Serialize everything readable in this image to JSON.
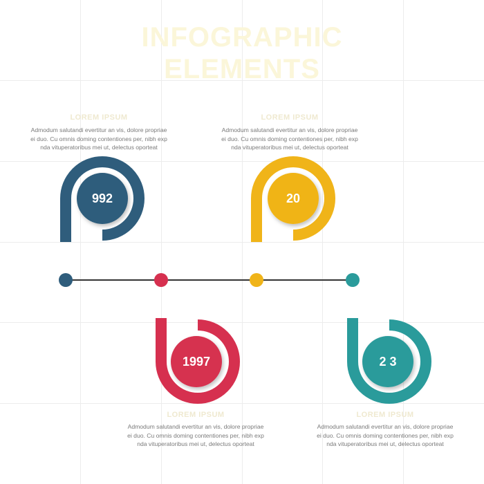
{
  "title": {
    "line1": "INFOGRAPHIC",
    "line2": "ELEMENTS"
  },
  "colors": {
    "steps": [
      "#2f5d7c",
      "#d6304f",
      "#f0b419",
      "#2a9b9b"
    ],
    "timeline": "#333333",
    "grid": "#ececec"
  },
  "steps": [
    {
      "year": "992",
      "heading": "LOREM IPSUM",
      "body": [
        "Admodum salutandi evertitur an vis, dolore propriae",
        "ei duo. Cu omnis doming contentiones per, nibh exp",
        "nda vituperatoribus mei ut, delectus oporteat"
      ]
    },
    {
      "year": "1997",
      "heading": "LOREM IPSUM",
      "body": [
        "Admodum salutandi evertitur an vis, dolore propriae",
        "ei duo. Cu omnis doming contentiones per, nibh exp",
        "nda vituperatoribus mei ut, delectus oporteat"
      ]
    },
    {
      "year": "20",
      "heading": "LOREM IPSUM",
      "body": [
        "Admodum salutandi evertitur an vis, dolore propriae",
        "ei duo. Cu omnis doming contentiones per, nibh exp",
        "nda vituperatoribus mei ut, delectus oporteat"
      ]
    },
    {
      "year": "2 3",
      "heading": "LOREM IPSUM",
      "body": [
        "Admodum salutandi evertitur an vis, dolore propriae",
        "ei duo. Cu omnis doming contentiones per, nibh exp",
        "nda vituperatoribus mei ut, delectus oporteat"
      ]
    }
  ]
}
